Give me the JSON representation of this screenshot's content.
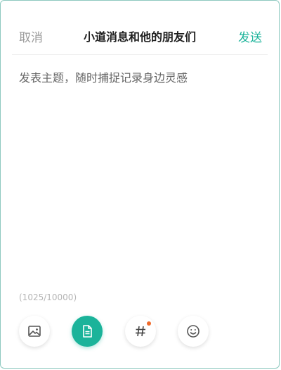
{
  "header": {
    "cancel_label": "取消",
    "title": "小道消息和他的朋友们",
    "send_label": "发送"
  },
  "editor": {
    "placeholder": "发表主题，随时捕捉记录身边灵感"
  },
  "counter": {
    "text": "(1025/10000)"
  },
  "toolbar": {
    "tools": [
      {
        "icon": "image-icon",
        "active": false
      },
      {
        "icon": "document-icon",
        "active": true
      },
      {
        "icon": "hashtag-icon",
        "active": false,
        "notification_dot": true
      },
      {
        "icon": "emoji-icon",
        "active": false
      }
    ]
  },
  "colors": {
    "accent": "#1bb39a",
    "notification_dot": "#f06a2a",
    "border": "#8ec9c0"
  }
}
